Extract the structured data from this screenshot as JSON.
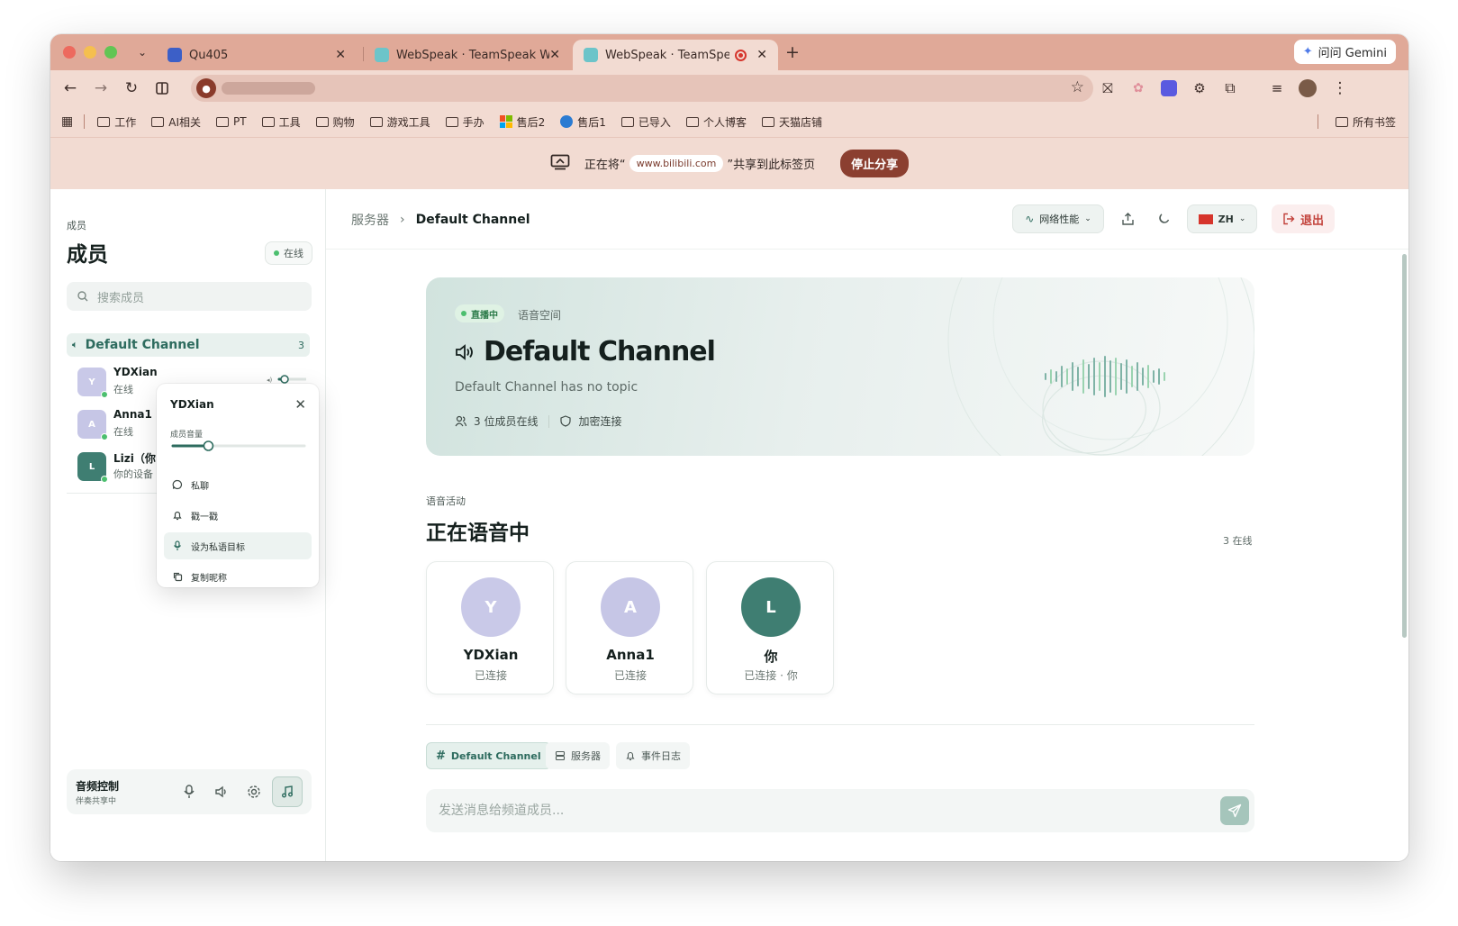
{
  "colors": {
    "accent": "#2d6b5e",
    "online": "#4cbf6f",
    "danger": "#c2413a",
    "avatar_y": "#c9c9e8",
    "avatar_a": "#c6c6e6",
    "avatar_l": "#3f7e72"
  },
  "browser": {
    "tabs": [
      {
        "title": "Qu405",
        "close": "✕",
        "icon": "document-favicon-icon"
      },
      {
        "title": "WebSpeak · TeamSpeak Web",
        "close": "✕",
        "icon": "webspeak-favicon-icon"
      },
      {
        "title": "WebSpeak · TeamSpeak Web",
        "close": "✕",
        "icon": "webspeak-favicon-icon",
        "active": true
      }
    ],
    "new_tab": "+",
    "gemini_label": "问问 Gemini",
    "bookmarks": [
      "工作",
      "AI相关",
      "PT",
      "工具",
      "购物",
      "游戏工具",
      "手办",
      "售后2",
      "售后1",
      "已导入",
      "个人博客",
      "天猫店铺"
    ],
    "all_bookmarks": "所有书签"
  },
  "share_bar": {
    "prefix": "正在将“",
    "site": "www.bilibili.com",
    "suffix": "”共享到此标签页",
    "stop_label": "停止分享"
  },
  "sidebar": {
    "eyebrow": "成员",
    "title": "成员",
    "status_chip": "在线",
    "search_placeholder": "搜索成员",
    "channel": {
      "name": "Default Channel",
      "count": "3"
    },
    "members": [
      {
        "initial": "Y",
        "name": "YDXian",
        "status": "在线",
        "volume": 0.2
      },
      {
        "initial": "A",
        "name": "Anna1",
        "status": "在线"
      },
      {
        "initial": "L",
        "name": "Lizi（你",
        "status": "你的设备"
      }
    ],
    "audio_panel": {
      "title": "音频控制",
      "subtitle": "伴奏共享中"
    }
  },
  "popover": {
    "title": "YDXian",
    "volume_label": "成员音量",
    "volume": 0.27,
    "items": [
      "私聊",
      "戳一戳",
      "设为私语目标",
      "复制昵称"
    ]
  },
  "header": {
    "crumb_root": "服务器",
    "crumb_sep": "›",
    "crumb_current": "Default Channel",
    "network_label": "网络性能",
    "lang_label": "ZH",
    "exit_label": "退出"
  },
  "hero": {
    "live_badge": "直播中",
    "space_label": "语音空间",
    "title": "Default Channel",
    "topic": "Default Channel has no topic",
    "members_online": "3 位成员在线",
    "encrypted": "加密连接"
  },
  "voice": {
    "eyebrow": "语音活动",
    "title": "正在语音中",
    "count_label": "3 在线",
    "cards": [
      {
        "initial": "Y",
        "name": "YDXian",
        "status": "已连接"
      },
      {
        "initial": "A",
        "name": "Anna1",
        "status": "已连接"
      },
      {
        "initial": "L",
        "name": "你",
        "status": "已连接 · 你"
      }
    ]
  },
  "content_tabs": [
    {
      "prefix": "#",
      "label": "Default Channel"
    },
    {
      "label": "服务器"
    },
    {
      "label": "事件日志"
    }
  ],
  "message": {
    "placeholder": "发送消息给频道成员..."
  }
}
